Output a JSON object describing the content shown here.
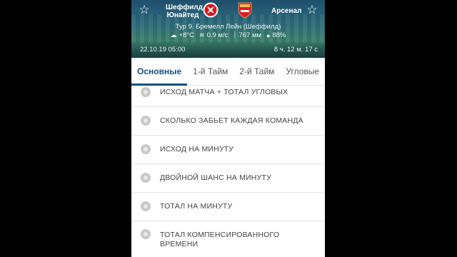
{
  "header": {
    "home_team": "Шеффилд Юнайтед",
    "away_team": "Арсенал",
    "round_venue": "Тур 9. Бремелл Лейн (Шеффилд)",
    "weather": {
      "temperature": "+8°C",
      "wind": "0.9 м/с",
      "pressure": "767 мм",
      "humidity": "88%"
    },
    "date_time": "22.10.19 05:00",
    "countdown": "8 ч. 12 м. 17 с",
    "icons": {
      "left_star": "star-outline-icon",
      "right_star": "star-outline-icon",
      "home_crest": "sheffield-united-crest",
      "away_crest": "arsenal-crest",
      "weather": "cloud-sun-icon",
      "wind": "wind-icon",
      "pressure": "thermometer-icon",
      "humidity": "droplet-icon"
    }
  },
  "tabs": [
    {
      "label": "Основные",
      "active": true
    },
    {
      "label": "1-й Тайм",
      "active": false
    },
    {
      "label": "2-й Тайм",
      "active": false
    },
    {
      "label": "Угловые",
      "active": false
    }
  ],
  "bet_items": [
    {
      "label": "ИСХОД МАТЧА + ТОТАЛ УГЛОВЫХ"
    },
    {
      "label": "СКОЛЬКО ЗАБЬЕТ КАЖДАЯ КОМАНДА"
    },
    {
      "label": "ИСХОД НА МИНУТУ"
    },
    {
      "label": "ДВОЙНОЙ ШАНС НА МИНУТУ"
    },
    {
      "label": "ТОТАЛ НА МИНУТУ"
    },
    {
      "label": "ТОТАЛ КОМПЕНСИРОВАННОГО ВРЕМЕНИ"
    }
  ],
  "colors": {
    "accent": "#1b4f7a",
    "header_bg": "#2c6a7c",
    "text": "#444444"
  }
}
